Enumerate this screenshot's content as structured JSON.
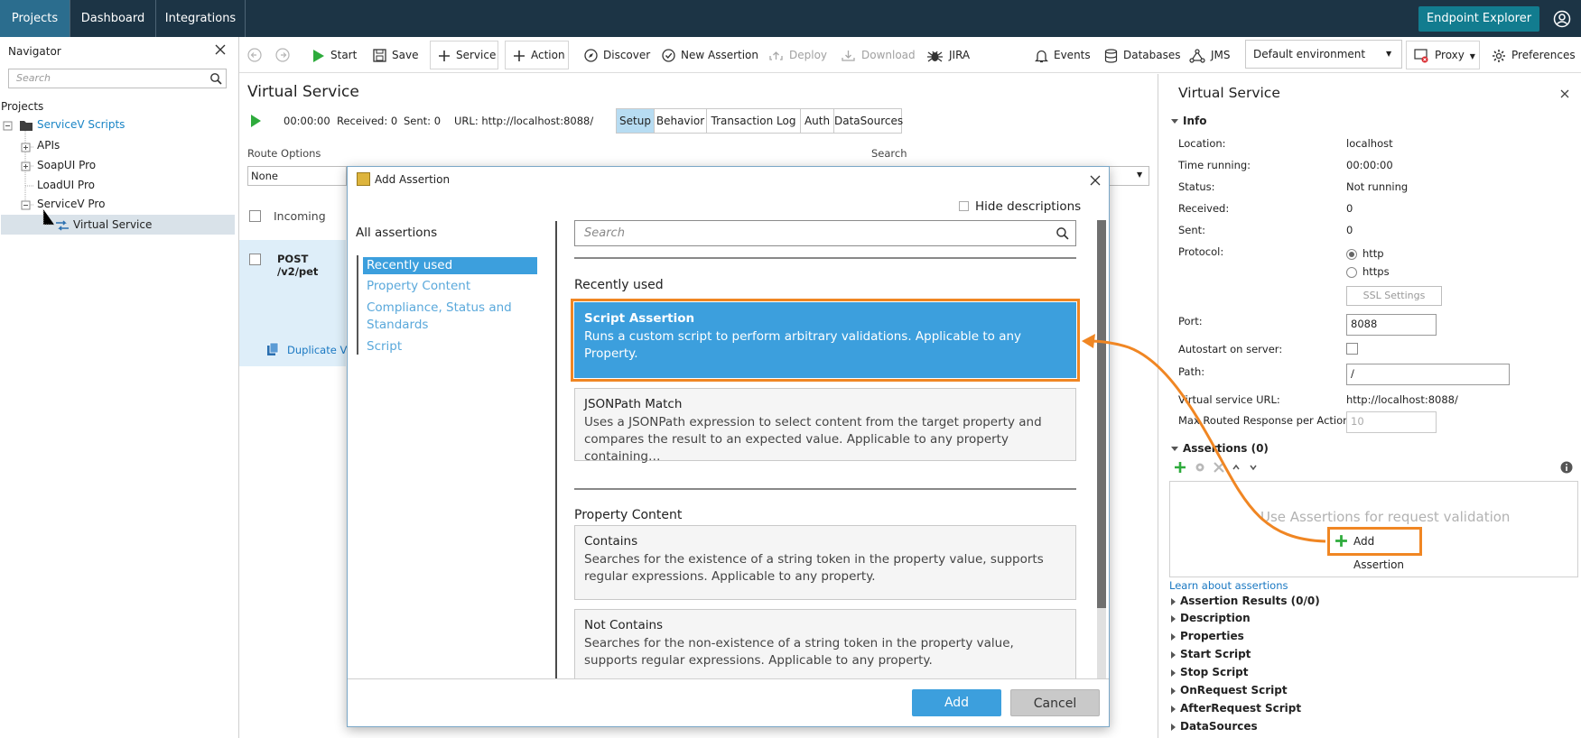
{
  "topbar": {
    "tabs": [
      "Projects",
      "Dashboard",
      "Integrations"
    ],
    "endpoint_explorer": "Endpoint Explorer",
    "accent": "#2b6d8e",
    "background": "#1c3445"
  },
  "navigator": {
    "title": "Navigator",
    "search_placeholder": "Search",
    "projects_label": "Projects",
    "tree": [
      "ServiceV Scripts",
      "APIs",
      "SoapUI Pro",
      "LoadUI Pro",
      "ServiceV Pro",
      "Virtual Service"
    ]
  },
  "toolbar": {
    "start": "Start",
    "save": "Save",
    "service": "Service",
    "action": "Action",
    "discover": "Discover",
    "new_assertion": "New Assertion",
    "deploy": "Deploy",
    "download": "Download",
    "jira": "JIRA",
    "events": "Events",
    "databases": "Databases",
    "jms": "JMS",
    "environment": "Default environment",
    "proxy": "Proxy",
    "preferences": "Preferences"
  },
  "virtual_service": {
    "title": "Virtual Service",
    "time": "00:00:00",
    "received": "Received: 0",
    "sent": "Sent: 0",
    "url": "URL: http://localhost:8088/",
    "tabs": [
      "Setup",
      "Behavior",
      "Transaction Log",
      "Auth",
      "DataSources"
    ],
    "route_options_label": "Route Options",
    "route_value": "None",
    "search_label": "Search",
    "incoming_label": "Incoming",
    "row_label": "POST /v2/pet",
    "duplicate_label": "Duplicate Vir"
  },
  "right_panel": {
    "title": "Virtual Service",
    "info_header": "Info",
    "labels": [
      "Location:",
      "Time running:",
      "Status:",
      "Received:",
      "Sent:",
      "Protocol:"
    ],
    "values": [
      "localhost",
      "00:00:00",
      "Not running",
      "0",
      "0"
    ],
    "protocol_options": [
      "http",
      "https"
    ],
    "ssl_settings": "SSL Settings",
    "port_label": "Port:",
    "port_value": "8088",
    "autostart_label": "Autostart on server:",
    "path_label": "Path:",
    "path_value": "/",
    "vs_url_label": "Virtual service URL:",
    "vs_url_value": "http://localhost:8088/",
    "max_routed_label": "Max Routed Response per Action:",
    "max_routed_placeholder": "10",
    "assertions_header": "Assertions (0)",
    "assert_empty": "Use Assertions for request validation",
    "add_assertion": "Add Assertion",
    "learn_link": "Learn about assertions",
    "collapsed_rows": [
      "Assertion Results (0/0)",
      "Description",
      "Properties",
      "Start Script",
      "Stop Script",
      "OnRequest Script",
      "AfterRequest Script",
      "DataSources"
    ]
  },
  "modal": {
    "title": "Add Assertion",
    "all_assertions": "All assertions",
    "categories": [
      "Recently used",
      "Property Content",
      "Compliance, Status and Standards",
      "Script"
    ],
    "hide_descriptions": "Hide descriptions",
    "search_placeholder": "Search",
    "recent_header": "Recently used",
    "script_assertion": {
      "title": "Script Assertion",
      "desc": "Runs a custom script to perform arbitrary validations. Applicable to any Property."
    },
    "jsonpath": {
      "title": "JSONPath Match",
      "desc": "Uses a JSONPath expression to select content from the target property and compares the result to an expected value. Applicable to any property containing…"
    },
    "property_header": "Property Content",
    "contains": {
      "title": "Contains",
      "desc": "Searches for the existence of a string token in the property value, supports regular expressions. Applicable to any property."
    },
    "not_contains": {
      "title": "Not Contains",
      "desc": "Searches for the non-existence of a string token in the property value, supports regular expressions. Applicable to any property."
    },
    "add_button": "Add",
    "cancel_button": "Cancel"
  },
  "colors": {
    "selected_blue": "#3c9fdd",
    "highlight_orange": "#f08623"
  }
}
